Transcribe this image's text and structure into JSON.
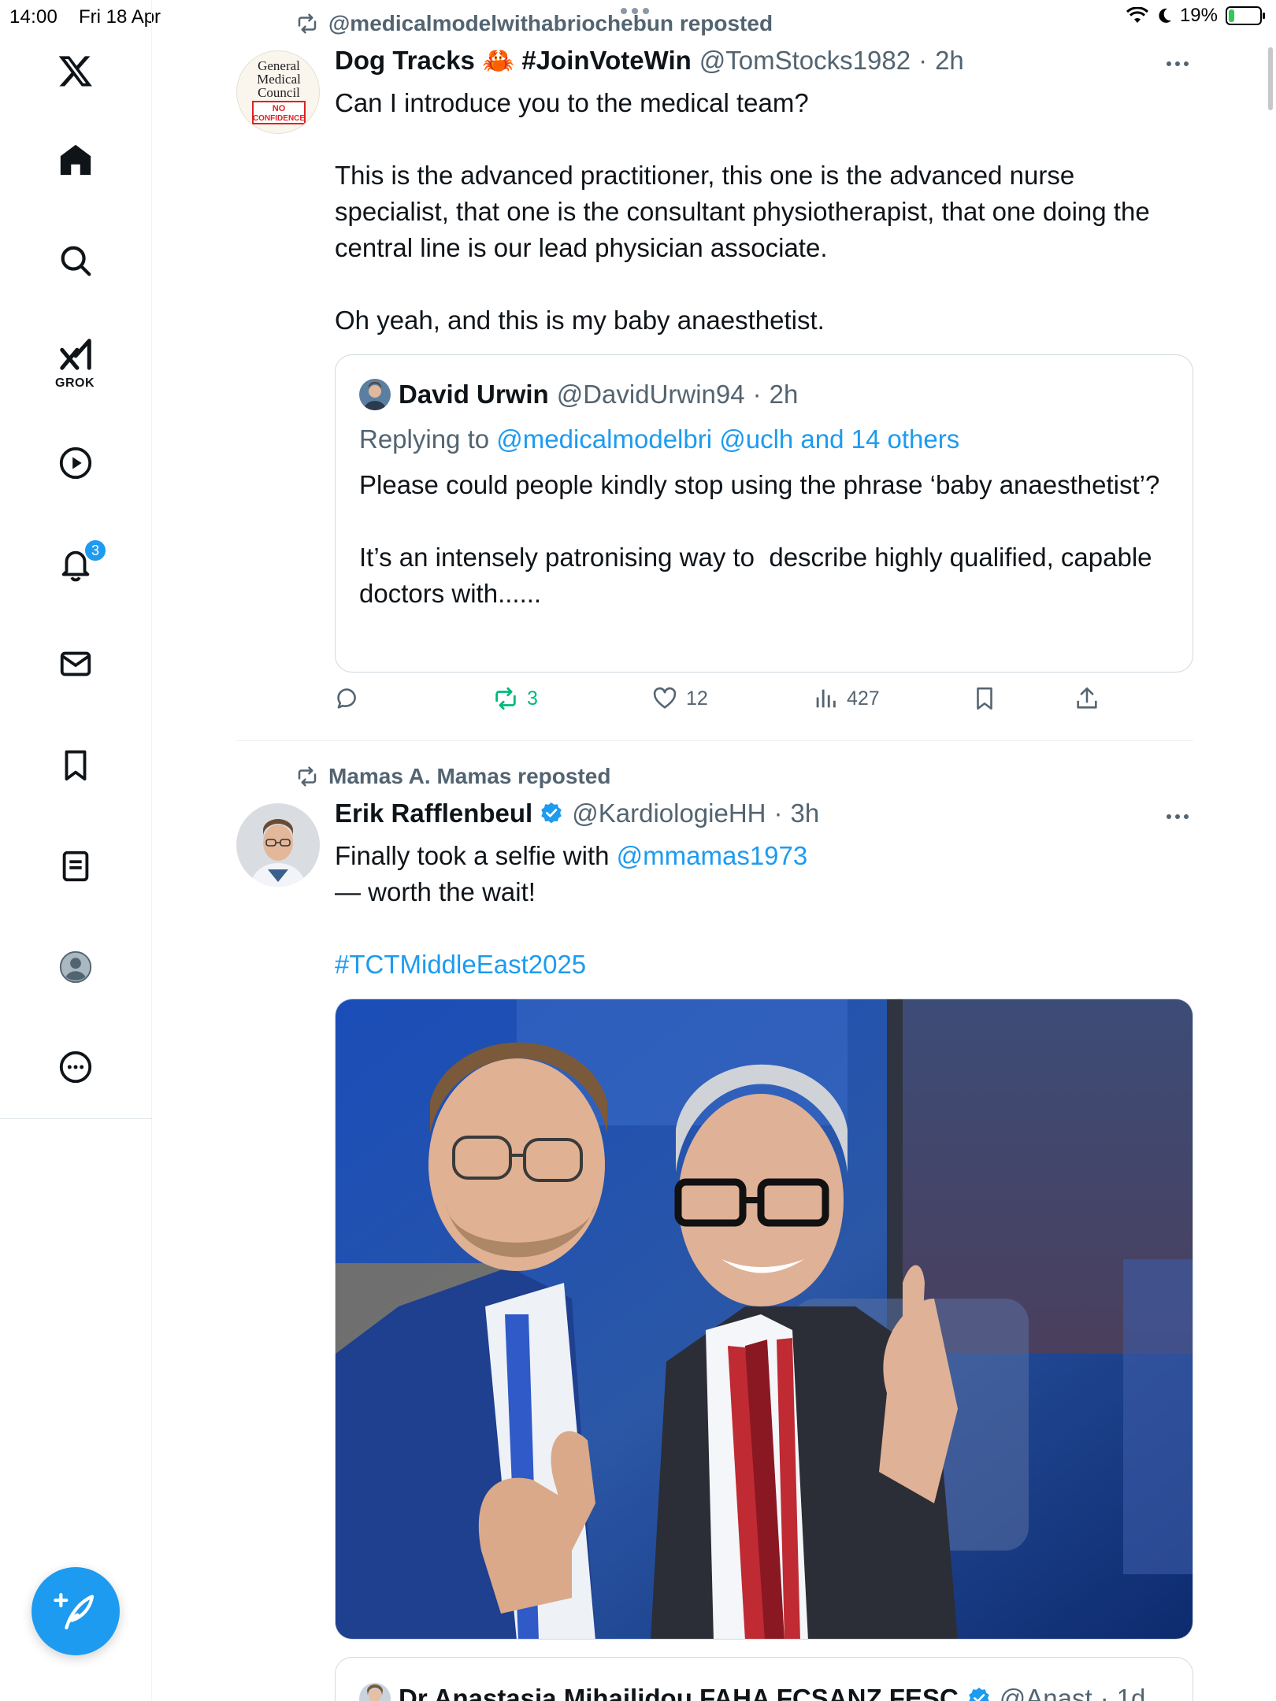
{
  "status_bar": {
    "time": "14:00",
    "date": "Fri 18 Apr",
    "battery": "19%",
    "battery_level": 0.19
  },
  "sidebar": {
    "grok_label": "GROK",
    "notification_count": "3"
  },
  "tweets": [
    {
      "repost_by": "@medicalmodelwithabriochebun reposted",
      "author_name": "Dog Tracks 🦀 #JoinVoteWin",
      "author_handle": "@TomStocks1982",
      "time": "2h",
      "avatar_lines": [
        "General",
        "Medical",
        "Council",
        "NO",
        "CONFIDENCE"
      ],
      "text": "Can I introduce you to the medical team?\n\nThis is the advanced practitioner, this one is the advanced nurse specialist, that one is the consultant physiotherapist, that one doing the central line is our lead physician associate.\n\nOh yeah, and this is my baby anaesthetist.",
      "quote": {
        "author_name": "David Urwin",
        "author_handle": "@DavidUrwin94",
        "time": "2h",
        "replying_prefix": "Replying to",
        "replying_to": "@medicalmodelbri @uclh and 14 others",
        "text": "Please could people kindly stop using the phrase ‘baby anaesthetist’?\n\nIt’s an intensely patronising way to  describe highly qualified, capable doctors with......"
      },
      "actions": {
        "reposts": "3",
        "likes": "12",
        "views": "427"
      }
    },
    {
      "repost_by": "Mamas A. Mamas reposted",
      "author_name": "Erik Rafflenbeul",
      "author_handle": "@KardiologieHH",
      "time": "3h",
      "text_before": "Finally took a selfie with ",
      "mention": "@mmamas1973",
      "text_after": "\n— worth the wait!",
      "hashtag": "#TCTMiddleEast2025",
      "quote_author": "Dr Anastasia Mihailidou FAHA FCSANZ FESC",
      "quote_handle": "@Anast",
      "quote_time": "1d"
    }
  ],
  "colors": {
    "accent": "#1d9bf0",
    "repost_green": "#00ba7c",
    "secondary_text": "#536471"
  }
}
